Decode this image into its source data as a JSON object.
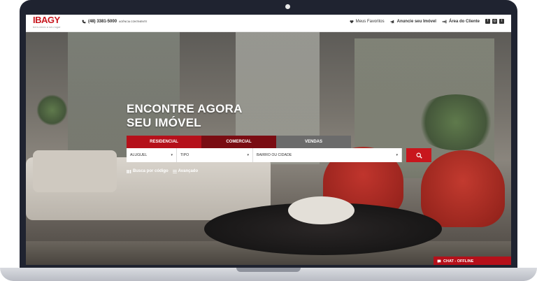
{
  "header": {
    "logo_text": "IBAGY",
    "logo_tagline": "bem-vindo a seu lugar",
    "phone": "(48) 3381-5000",
    "phone_note": "AGÊNCIA CONTINENTE",
    "nav": [
      {
        "label": "Meus Favoritos",
        "icon": "heart-icon"
      },
      {
        "label": "Anuncie seu Imóvel",
        "icon": "megaphone-icon"
      },
      {
        "label": "Área do Cliente",
        "icon": "login-icon"
      }
    ],
    "social": [
      "facebook-icon",
      "instagram-icon",
      "twitter-icon"
    ]
  },
  "hero": {
    "headline_line1": "ENCONTRE AGORA",
    "headline_line2": "SEU IMÓVEL",
    "tabs": [
      "RESIDENCIAL",
      "COMERCIAL",
      "VENDAS"
    ],
    "filters": {
      "transaction": "ALUGUEL",
      "type": "TIPO",
      "location": "BAIRRO OU CIDADE"
    },
    "links": [
      "Busca por código",
      "Avançado"
    ]
  },
  "chat": {
    "label": "CHAT - OFFLINE"
  },
  "colors": {
    "brand_red": "#c8161d",
    "tab_residencial": "#b5101a",
    "tab_comercial": "#7a0c12",
    "tab_vendas": "#6b6b6b"
  }
}
